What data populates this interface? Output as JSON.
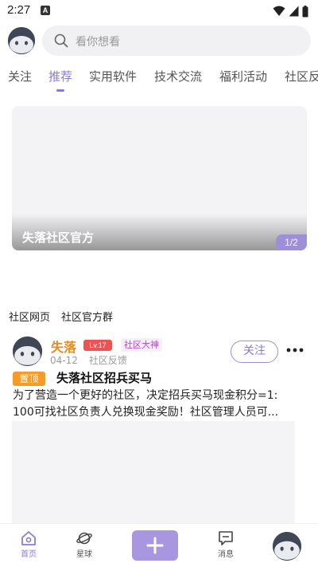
{
  "status_bar": {
    "time": "2:27",
    "notification_letter": "A"
  },
  "search": {
    "placeholder": "看你想看"
  },
  "tabs": [
    {
      "label": "关注",
      "active": false
    },
    {
      "label": "推荐",
      "active": true
    },
    {
      "label": "实用软件",
      "active": false
    },
    {
      "label": "技术交流",
      "active": false
    },
    {
      "label": "福利活动",
      "active": false
    },
    {
      "label": "社区反",
      "active": false
    }
  ],
  "banner": {
    "title": "失落社区官方",
    "pager": "1/2"
  },
  "quick_links": [
    "社区网页",
    "社区官方群"
  ],
  "post": {
    "author": "失落",
    "level": "Lv.17",
    "title_badge": "社区大神",
    "date": "04-12",
    "category": "社区反馈",
    "follow_label": "关注",
    "pin_label": "置顶",
    "title": "失落社区招兵买马",
    "body_line1": "为了营造一个更好的社区，决定招兵买马现金积分=1:",
    "body_line2": "100可找社区负责人兑换现金奖励！社区管理人员可..."
  },
  "bottom_nav": {
    "home": "首页",
    "planet": "星球",
    "messages": "消息"
  },
  "colors": {
    "accent": "#8a7bd6",
    "author": "#ec8b1c",
    "level_badge": "#ee5252",
    "pin_badge": "#f59b27"
  }
}
